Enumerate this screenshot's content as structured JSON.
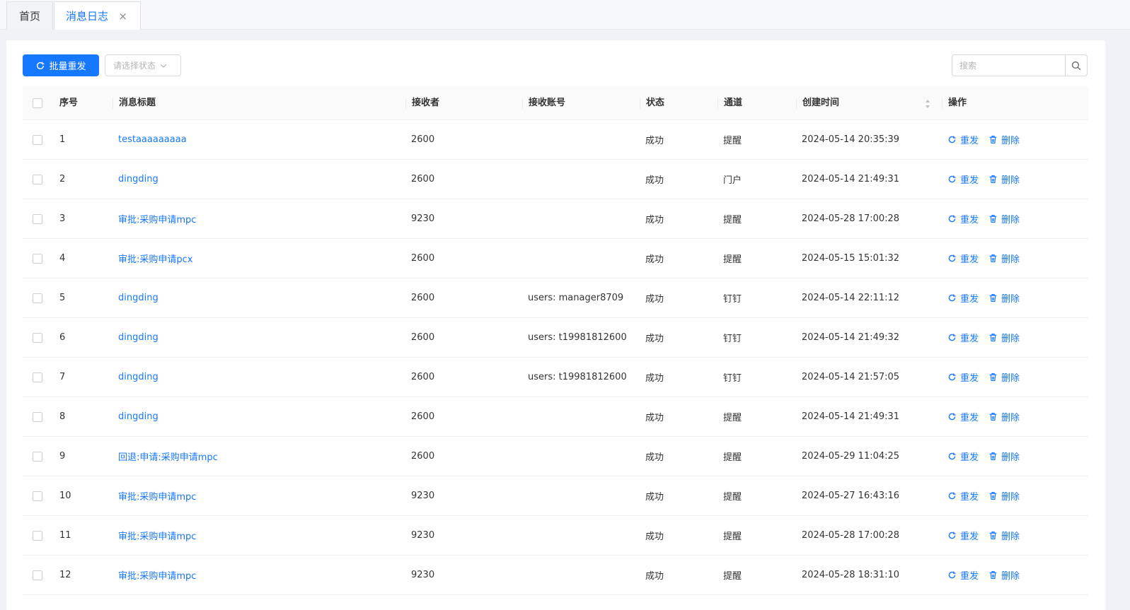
{
  "tabs": {
    "home": "首页",
    "active": "消息日志",
    "close_glyph": "×"
  },
  "toolbar": {
    "batch_resend": "批量重发",
    "status_placeholder": "请选择状态",
    "search_placeholder": "搜索"
  },
  "table": {
    "headers": {
      "index": "序号",
      "title": "消息标题",
      "receiver": "接收者",
      "account": "接收账号",
      "status": "状态",
      "channel": "通道",
      "created": "创建时间",
      "ops": "操作"
    },
    "resend": "重发",
    "delete": "删除",
    "rows": [
      {
        "no": "1",
        "title": "testaaaaaaaaa",
        "receiver": "2600",
        "account": "",
        "status": "成功",
        "channel": "提醒",
        "created": "2024-05-14 20:35:39"
      },
      {
        "no": "2",
        "title": "dingding",
        "receiver": "2600",
        "account": "",
        "status": "成功",
        "channel": "门户",
        "created": "2024-05-14 21:49:31"
      },
      {
        "no": "3",
        "title": "审批:采购申请mpc",
        "receiver": "9230",
        "account": "",
        "status": "成功",
        "channel": "提醒",
        "created": "2024-05-28 17:00:28"
      },
      {
        "no": "4",
        "title": "审批:采购申请pcx",
        "receiver": "2600",
        "account": "",
        "status": "成功",
        "channel": "提醒",
        "created": "2024-05-15 15:01:32"
      },
      {
        "no": "5",
        "title": "dingding",
        "receiver": "2600",
        "account": "users: manager8709",
        "status": "成功",
        "channel": "钉钉",
        "created": "2024-05-14 22:11:12"
      },
      {
        "no": "6",
        "title": "dingding",
        "receiver": "2600",
        "account": "users: t19981812600",
        "status": "成功",
        "channel": "钉钉",
        "created": "2024-05-14 21:49:32"
      },
      {
        "no": "7",
        "title": "dingding",
        "receiver": "2600",
        "account": "users: t19981812600",
        "status": "成功",
        "channel": "钉钉",
        "created": "2024-05-14 21:57:05"
      },
      {
        "no": "8",
        "title": "dingding",
        "receiver": "2600",
        "account": "",
        "status": "成功",
        "channel": "提醒",
        "created": "2024-05-14 21:49:31"
      },
      {
        "no": "9",
        "title": "回退:申请:采购申请mpc",
        "receiver": "2600",
        "account": "",
        "status": "成功",
        "channel": "提醒",
        "created": "2024-05-29 11:04:25"
      },
      {
        "no": "10",
        "title": "审批:采购申请mpc",
        "receiver": "9230",
        "account": "",
        "status": "成功",
        "channel": "提醒",
        "created": "2024-05-27 16:43:16"
      },
      {
        "no": "11",
        "title": "审批:采购申请mpc",
        "receiver": "9230",
        "account": "",
        "status": "成功",
        "channel": "提醒",
        "created": "2024-05-28 17:00:28"
      },
      {
        "no": "12",
        "title": "审批:采购申请mpc",
        "receiver": "9230",
        "account": "",
        "status": "成功",
        "channel": "提醒",
        "created": "2024-05-28 18:31:10"
      }
    ]
  }
}
